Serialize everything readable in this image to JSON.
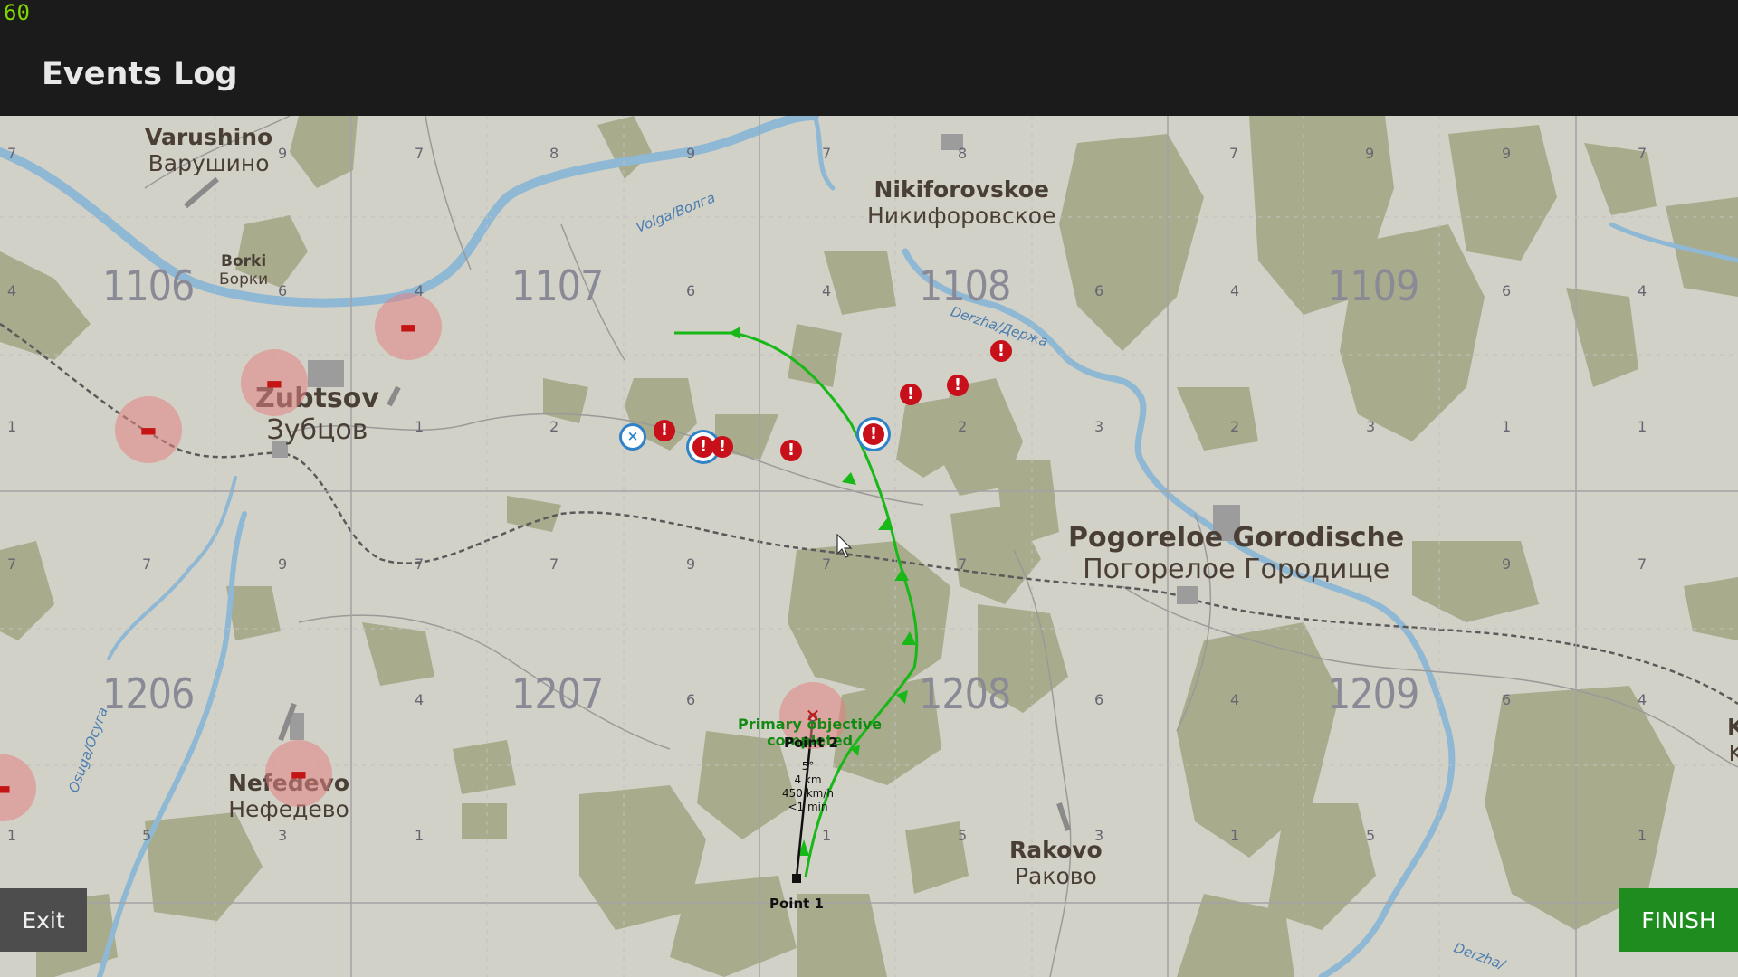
{
  "hud": {
    "fps": "60"
  },
  "header": {
    "title": "Events Log"
  },
  "buttons": {
    "exit": "Exit",
    "finish": "FINISH"
  },
  "map": {
    "grid_squares": [
      "1106",
      "1107",
      "1108",
      "1109",
      "1206",
      "1207",
      "1208",
      "1209"
    ],
    "towns": [
      {
        "en": "Varushino",
        "ru": "Варушино"
      },
      {
        "en": "Borki",
        "ru": "Борки"
      },
      {
        "en": "Zubtsov",
        "ru": "Зубцов"
      },
      {
        "en": "Nikiforovskoe",
        "ru": "Никифоровское"
      },
      {
        "en": "Pogoreloe Gorodische",
        "ru": "Погорелое Городище"
      },
      {
        "en": "Nefedevo",
        "ru": "Нефедево"
      },
      {
        "en": "Rakovo",
        "ru": "Раково"
      }
    ],
    "rivers": [
      "Volga/Волга",
      "Derzha/Держа",
      "Osuga/Осуга",
      "Derzha/"
    ],
    "edge_label": {
      "top": "K",
      "bottom": "K"
    },
    "row_numbers": {
      "r7": [
        "7",
        "9",
        "7",
        "8",
        "9",
        "7",
        "8",
        "9",
        "7",
        "8",
        "9",
        "7"
      ],
      "r4": [
        "4",
        "6",
        "4",
        "5",
        "6",
        "4",
        "5",
        "6",
        "4",
        "5",
        "6",
        "4"
      ],
      "r1": [
        "1",
        "3",
        "1",
        "2",
        "3",
        "1",
        "2",
        "3",
        "1",
        "2",
        "3",
        "1"
      ]
    }
  },
  "flight_plan": {
    "start": "Point 1",
    "end": "Point 2",
    "heading": "5°",
    "distance": "4 km",
    "speed": "450 km/h",
    "time": "<1 min",
    "objective_line1": "Primary objective",
    "objective_line2": "completed"
  },
  "markers": {
    "alert_symbol": "!",
    "friendly_symbol": "×"
  },
  "colors": {
    "route": "#17b817",
    "enemy": "#c8101a",
    "friendly": "#2f82c8",
    "forest": "#a8ab8c",
    "water": "#8fb8d4",
    "finish": "#1e8c1e"
  }
}
